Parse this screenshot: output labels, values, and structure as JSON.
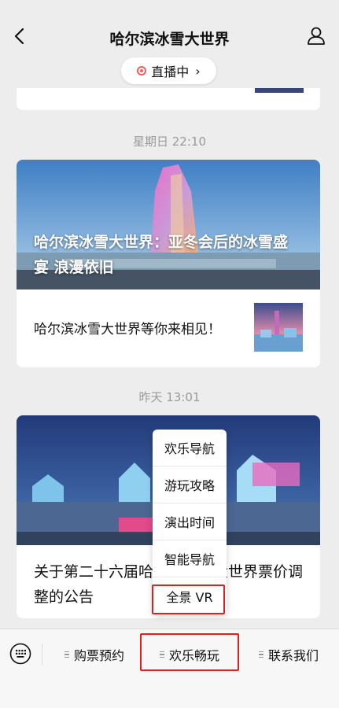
{
  "header": {
    "title": "哈尔滨冰雪大世界",
    "back_icon": "chevron-left-icon",
    "user_icon": "user-icon",
    "live_label": "直播中",
    "live_chevron": "›"
  },
  "feed": [
    {
      "timestamp": "星期日 22:10",
      "hero_title": "哈尔滨冰雪大世界：亚冬会后的冰雪盛宴 浪漫依旧",
      "row_text": "哈尔滨冰雪大世界等你来相见！"
    },
    {
      "timestamp": "昨天 13:01",
      "title": "关于第二十六届哈尔滨冰雪大世界票价调整的公告"
    }
  ],
  "menu": {
    "items": [
      "欢乐导航",
      "游玩攻略",
      "演出时间",
      "智能导航",
      "全景 VR"
    ],
    "highlighted": "全景 VR"
  },
  "tabbar": {
    "keyboard_icon": "keyboard-icon",
    "tabs": [
      "购票预约",
      "欢乐畅玩",
      "联系我们"
    ],
    "active": "欢乐畅玩"
  },
  "colors": {
    "background": "#ededed",
    "live_dot": "#f06060",
    "highlight_box": "#e02020",
    "timestamp_text": "#9a9a9a"
  }
}
